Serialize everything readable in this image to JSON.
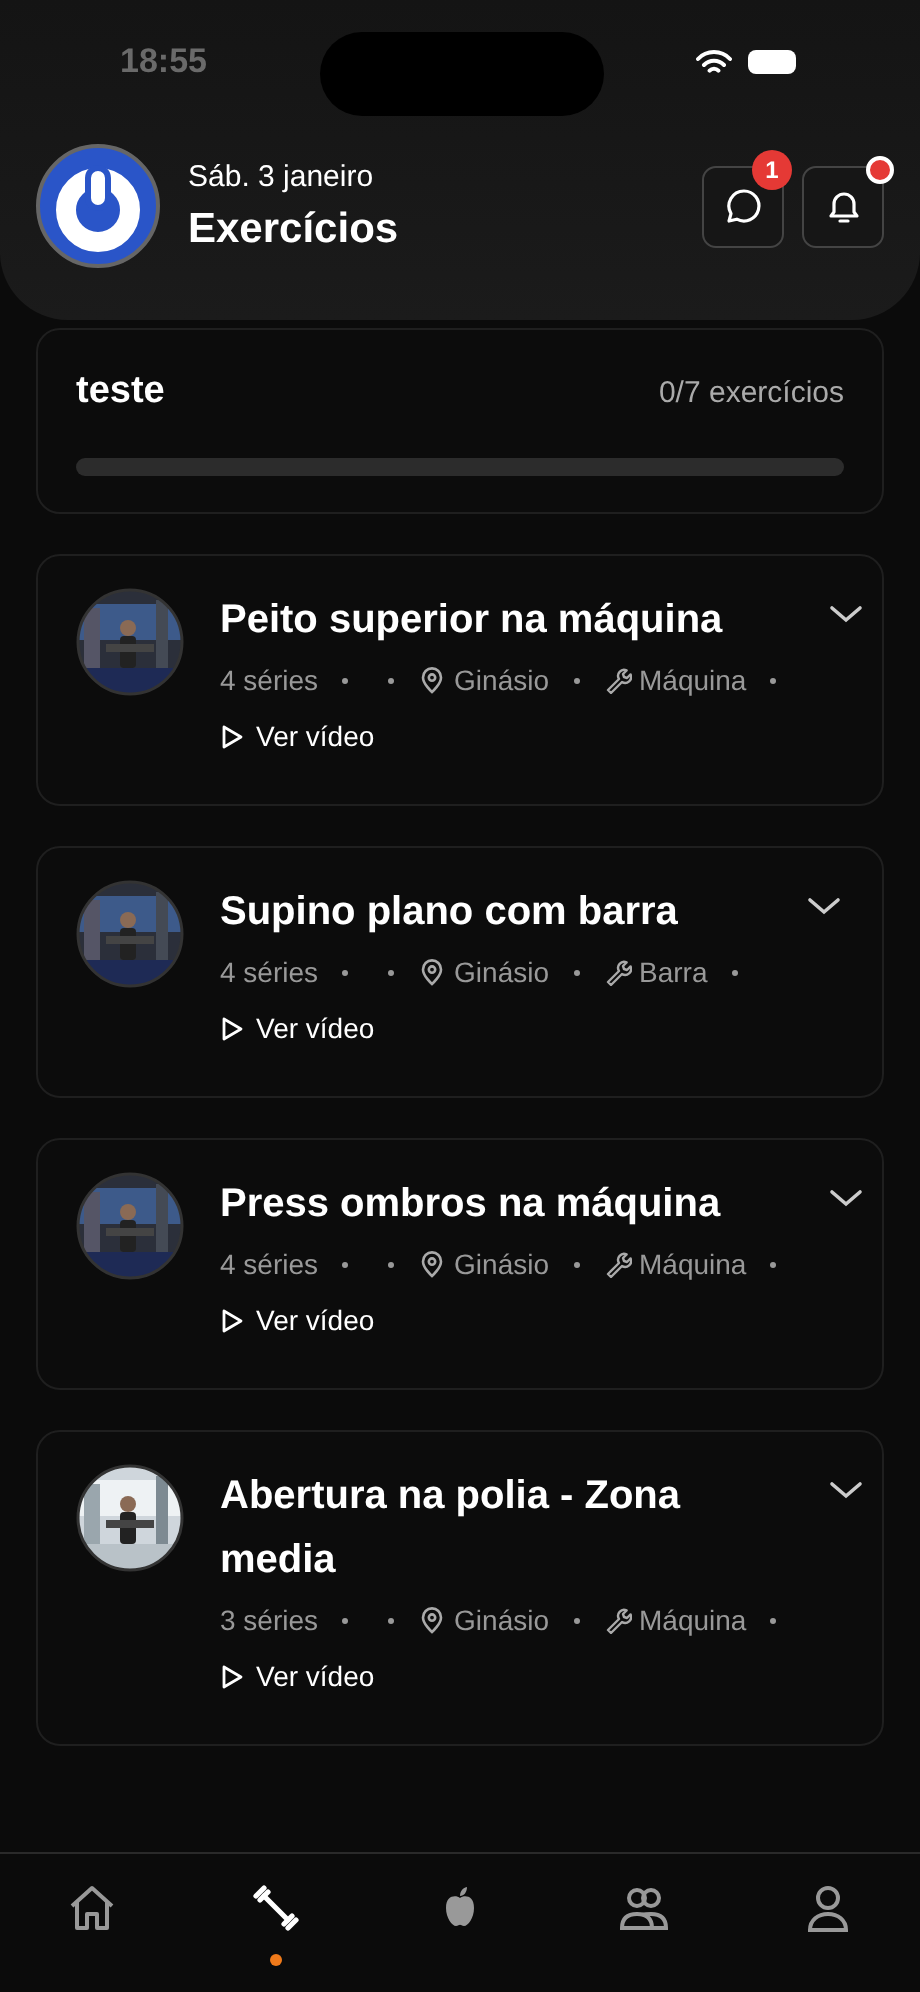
{
  "status_bar": {
    "time": "18:55"
  },
  "header": {
    "date": "Sáb. 3 janeiro",
    "title": "Exercícios",
    "messages_badge": "1",
    "notifications_unread": true
  },
  "workout": {
    "name": "teste",
    "progress_text": "0/7 exercícios",
    "level": 0
  },
  "exercises": [
    {
      "name": "Peito superior na máquina",
      "sets": "4 séries",
      "location": "Ginásio",
      "equipment": "Máquina",
      "video_label": "Ver vídeo",
      "expanded": false
    },
    {
      "name": "Supino plano com barra",
      "sets": "4 séries",
      "location": "Ginásio",
      "equipment": "Barra",
      "video_label": "Ver vídeo",
      "expanded": false
    },
    {
      "name": "Press ombros na máquina",
      "sets": "4 séries",
      "location": "Ginásio",
      "equipment": "Máquina",
      "video_label": "Ver vídeo",
      "expanded": false
    },
    {
      "name": "Abertura na polia - Zona media",
      "sets": "3 séries",
      "location": "Ginásio",
      "equipment": "Máquina",
      "video_label": "Ver vídeo",
      "expanded": false
    }
  ],
  "nav": [
    {
      "kind": "home",
      "selected": false
    },
    {
      "kind": "workout",
      "selected": true
    },
    {
      "kind": "nutrition",
      "selected": false
    },
    {
      "kind": "community",
      "selected": false
    },
    {
      "kind": "profile",
      "selected": false
    }
  ]
}
